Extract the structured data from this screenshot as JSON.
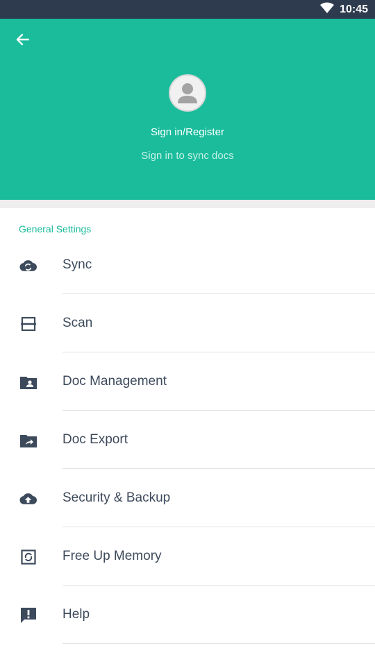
{
  "status_bar": {
    "time": "10:45",
    "icons": [
      "wifi-icon"
    ]
  },
  "header": {
    "back_icon": "arrow-left-icon",
    "avatar_icon": "person-icon",
    "title": "Sign in/Register",
    "subtitle": "Sign in to sync docs",
    "background_color": "#1abc9c"
  },
  "section": {
    "title": "General Settings",
    "accent_color": "#1abc9c"
  },
  "settings": [
    {
      "label": "Sync",
      "icon": "cloud-sync-icon"
    },
    {
      "label": "Scan",
      "icon": "scanner-icon"
    },
    {
      "label": "Doc Management",
      "icon": "folder-person-icon"
    },
    {
      "label": "Doc Export",
      "icon": "folder-share-icon"
    },
    {
      "label": "Security & Backup",
      "icon": "cloud-upload-icon"
    },
    {
      "label": "Free Up Memory",
      "icon": "memory-refresh-icon"
    },
    {
      "label": "Help",
      "icon": "feedback-icon"
    }
  ]
}
